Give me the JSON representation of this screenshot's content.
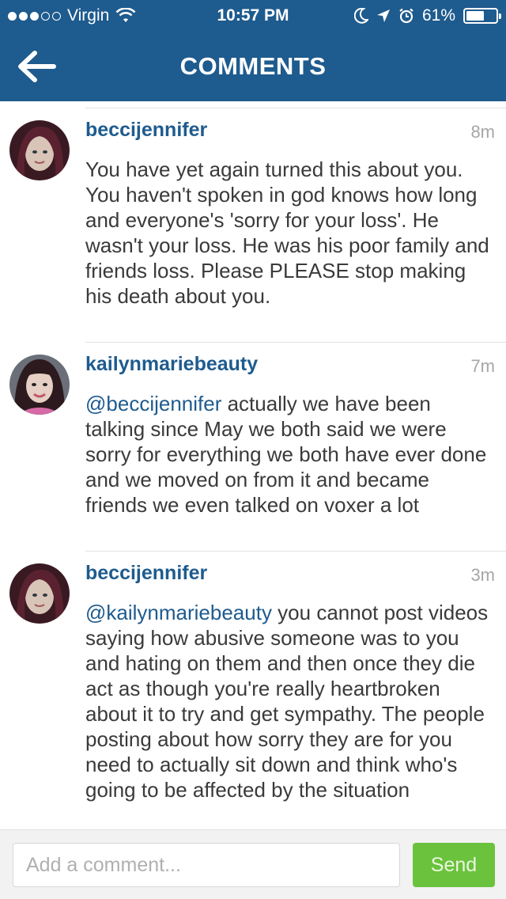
{
  "status_bar": {
    "carrier": "Virgin",
    "signal_dots_filled": 3,
    "signal_dots_total": 5,
    "time": "10:57 PM",
    "battery_percent_label": "61%",
    "battery_level": 0.61,
    "icons": [
      "wifi-icon",
      "do-not-disturb-moon-icon",
      "location-arrow-icon",
      "alarm-clock-icon",
      "battery-icon"
    ]
  },
  "header": {
    "title": "COMMENTS",
    "back_icon": "back-arrow-icon",
    "background_color": "#1e5b8e"
  },
  "comments": [
    {
      "username": "beccijennifer",
      "time": "8m",
      "mention": "",
      "body": "You have yet again turned this about you. You haven't spoken in god knows how long and everyone's 'sorry for your loss'. He wasn't your loss. He was his poor family and friends loss. Please PLEASE stop making his death about you."
    },
    {
      "username": "kailynmariebeauty",
      "time": "7m",
      "mention": "@beccijennifer",
      "body": " actually we have been talking since May we both said we were sorry for everything we both have ever done and we moved on from it and became friends we even talked on voxer a lot"
    },
    {
      "username": "beccijennifer",
      "time": "3m",
      "mention": "@kailynmariebeauty",
      "body": " you cannot post videos saying how abusive someone was to you and hating on them and then once they die act as though you're really heartbroken about it to try and get sympathy. The people posting about how sorry they are for you need to actually sit down and think who's going to be affected by the situation"
    }
  ],
  "input_bar": {
    "placeholder": "Add a comment...",
    "value": "",
    "send_label": "Send",
    "send_color": "#6bc23d"
  }
}
